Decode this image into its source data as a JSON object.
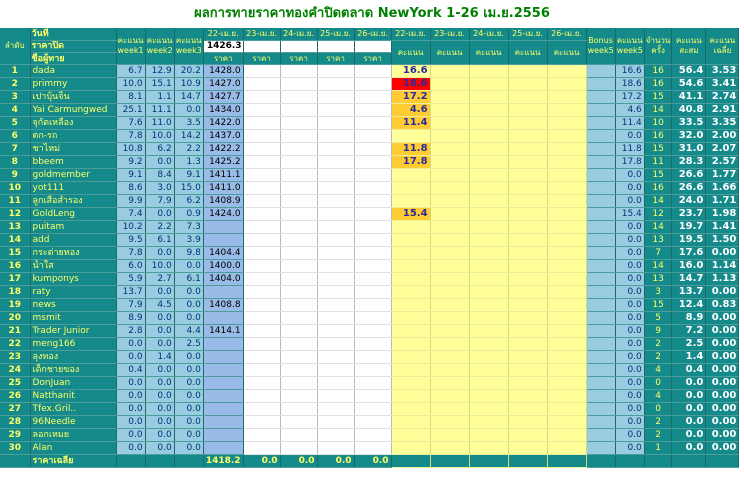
{
  "title": "ผลการทายราคาทองคำปิดตลาด NewYork 1-26 เม.ย.2556",
  "headers": {
    "date_label": "วันที่",
    "close_label": "ราคาปิด",
    "player_label": "ชื่อผู้ทาย",
    "rank_label": "ลำดับ",
    "week1": "คะแนน week1",
    "week2": "คะแนน week2",
    "week3": "คะแนน week3",
    "pred_dates": [
      "22-เม.ย.",
      "23-เม.ย.",
      "24-เม.ย.",
      "25-เม.ย.",
      "26-เม.ย."
    ],
    "score_dates": [
      "22-เม.ย.",
      "23-เม.ย.",
      "24-เม.ย.",
      "25-เม.ย.",
      "26-เม.ย."
    ],
    "close_price_22": "1426.3",
    "price_label": "ราคา",
    "score_label": "คะแนน",
    "bonus": "Bonus week5",
    "week5": "คะแนน week5",
    "count": "จำนวนครั้ง",
    "total": "คะแนนสะสม",
    "avg": "คะแนนเฉลี่ย"
  },
  "rows": [
    {
      "no": "1",
      "name": "dada",
      "w1": "6.7",
      "w2": "12.9",
      "w3": "20.2",
      "p22": "1428.0",
      "s22": "16.6",
      "w5": "16.6",
      "cnt": "16",
      "tot": "56.4",
      "avg": "3.53"
    },
    {
      "no": "2",
      "name": "primmy",
      "w1": "10.0",
      "w2": "15.1",
      "w3": "10.9",
      "p22": "1427.0",
      "s22": "18.6",
      "w5": "18.6",
      "cnt": "16",
      "tot": "54.6",
      "avg": "3.41"
    },
    {
      "no": "3",
      "name": "เปาบุ้นจิ้น",
      "w1": "8.1",
      "w2": "1.1",
      "w3": "14.7",
      "p22": "1427.7",
      "s22": "17.2",
      "w5": "17.2",
      "cnt": "15",
      "tot": "41.1",
      "avg": "2.74"
    },
    {
      "no": "4",
      "name": "Yai Carmungwed",
      "w1": "25.1",
      "w2": "11.1",
      "w3": "0.0",
      "p22": "1434.0",
      "s22": "4.6",
      "w5": "4.6",
      "cnt": "14",
      "tot": "40.8",
      "avg": "2.91"
    },
    {
      "no": "5",
      "name": "จุกัดเหลือง",
      "w1": "7.6",
      "w2": "11.0",
      "w3": "3.5",
      "p22": "1422.0",
      "s22": "11.4",
      "w5": "11.4",
      "cnt": "10",
      "tot": "33.5",
      "avg": "3.35"
    },
    {
      "no": "6",
      "name": "ตก-รถ",
      "w1": "7.8",
      "w2": "10.0",
      "w3": "14.2",
      "p22": "1437.0",
      "s22": "",
      "w5": "0.0",
      "cnt": "16",
      "tot": "32.0",
      "avg": "2.00"
    },
    {
      "no": "7",
      "name": "ชาไหม่",
      "w1": "10.8",
      "w2": "6.2",
      "w3": "2.2",
      "p22": "1422.2",
      "s22": "11.8",
      "w5": "11.8",
      "cnt": "15",
      "tot": "31.0",
      "avg": "2.07"
    },
    {
      "no": "8",
      "name": "bbeem",
      "w1": "9.2",
      "w2": "0.0",
      "w3": "1.3",
      "p22": "1425.2",
      "s22": "17.8",
      "w5": "17.8",
      "cnt": "11",
      "tot": "28.3",
      "avg": "2.57"
    },
    {
      "no": "9",
      "name": "goldmember",
      "w1": "9.1",
      "w2": "8.4",
      "w3": "9.1",
      "p22": "1411.1",
      "s22": "",
      "w5": "0.0",
      "cnt": "15",
      "tot": "26.6",
      "avg": "1.77"
    },
    {
      "no": "10",
      "name": "yot111",
      "w1": "8.6",
      "w2": "3.0",
      "w3": "15.0",
      "p22": "1411.0",
      "s22": "",
      "w5": "0.0",
      "cnt": "16",
      "tot": "26.6",
      "avg": "1.66"
    },
    {
      "no": "11",
      "name": "ลูกเสือสำรอง",
      "w1": "9.9",
      "w2": "7.9",
      "w3": "6.2",
      "p22": "1408.9",
      "s22": "",
      "w5": "0.0",
      "cnt": "14",
      "tot": "24.0",
      "avg": "1.71"
    },
    {
      "no": "12",
      "name": "GoldLeng",
      "w1": "7.4",
      "w2": "0.0",
      "w3": "0.9",
      "p22": "1424.0",
      "s22": "15.4",
      "w5": "15.4",
      "cnt": "12",
      "tot": "23.7",
      "avg": "1.98"
    },
    {
      "no": "13",
      "name": "puitam",
      "w1": "10.2",
      "w2": "2.2",
      "w3": "7.3",
      "p22": "",
      "s22": "",
      "w5": "0.0",
      "cnt": "14",
      "tot": "19.7",
      "avg": "1.41"
    },
    {
      "no": "14",
      "name": "add",
      "w1": "9.5",
      "w2": "6.1",
      "w3": "3.9",
      "p22": "",
      "s22": "",
      "w5": "0.0",
      "cnt": "13",
      "tot": "19.5",
      "avg": "1.50"
    },
    {
      "no": "15",
      "name": "กระต่ายทอง",
      "w1": "7.8",
      "w2": "0.0",
      "w3": "9.8",
      "p22": "1404.4",
      "s22": "",
      "w5": "0.0",
      "cnt": "7",
      "tot": "17.6",
      "avg": "0.00"
    },
    {
      "no": "16",
      "name": "น้ำใส",
      "w1": "6.0",
      "w2": "10.0",
      "w3": "0.0",
      "p22": "1400.0",
      "s22": "",
      "w5": "0.0",
      "cnt": "14",
      "tot": "16.0",
      "avg": "1.14"
    },
    {
      "no": "17",
      "name": "kumponys",
      "w1": "5.9",
      "w2": "2.7",
      "w3": "6.1",
      "p22": "1404.0",
      "s22": "",
      "w5": "0.0",
      "cnt": "13",
      "tot": "14.7",
      "avg": "1.13"
    },
    {
      "no": "18",
      "name": "raty",
      "w1": "13.7",
      "w2": "0.0",
      "w3": "0.0",
      "p22": "",
      "s22": "",
      "w5": "0.0",
      "cnt": "3",
      "tot": "13.7",
      "avg": "0.00"
    },
    {
      "no": "19",
      "name": "news",
      "w1": "7.9",
      "w2": "4.5",
      "w3": "0.0",
      "p22": "1408.8",
      "s22": "",
      "w5": "0.0",
      "cnt": "15",
      "tot": "12.4",
      "avg": "0.83"
    },
    {
      "no": "20",
      "name": "msmit",
      "w1": "8.9",
      "w2": "0.0",
      "w3": "0.0",
      "p22": "",
      "s22": "",
      "w5": "0.0",
      "cnt": "5",
      "tot": "8.9",
      "avg": "0.00"
    },
    {
      "no": "21",
      "name": "Trader Junior",
      "w1": "2.8",
      "w2": "0.0",
      "w3": "4.4",
      "p22": "1414.1",
      "s22": "",
      "w5": "0.0",
      "cnt": "9",
      "tot": "7.2",
      "avg": "0.00"
    },
    {
      "no": "22",
      "name": "meng166",
      "w1": "0.0",
      "w2": "0.0",
      "w3": "2.5",
      "p22": "",
      "s22": "",
      "w5": "0.0",
      "cnt": "2",
      "tot": "2.5",
      "avg": "0.00"
    },
    {
      "no": "23",
      "name": "ลุงทอง",
      "w1": "0.0",
      "w2": "1.4",
      "w3": "0.0",
      "p22": "",
      "s22": "",
      "w5": "0.0",
      "cnt": "2",
      "tot": "1.4",
      "avg": "0.00"
    },
    {
      "no": "24",
      "name": "เด็กชายของ",
      "w1": "0.4",
      "w2": "0.0",
      "w3": "0.0",
      "p22": "",
      "s22": "",
      "w5": "0.0",
      "cnt": "4",
      "tot": "0.4",
      "avg": "0.00"
    },
    {
      "no": "25",
      "name": "DonJuan",
      "w1": "0.0",
      "w2": "0.0",
      "w3": "0.0",
      "p22": "",
      "s22": "",
      "w5": "0.0",
      "cnt": "0",
      "tot": "0.0",
      "avg": "0.00"
    },
    {
      "no": "26",
      "name": "Natthanit",
      "w1": "0.0",
      "w2": "0.0",
      "w3": "0.0",
      "p22": "",
      "s22": "",
      "w5": "0.0",
      "cnt": "4",
      "tot": "0.0",
      "avg": "0.00"
    },
    {
      "no": "27",
      "name": "Tfex.Gril..",
      "w1": "0.0",
      "w2": "0.0",
      "w3": "0.0",
      "p22": "",
      "s22": "",
      "w5": "0.0",
      "cnt": "0",
      "tot": "0.0",
      "avg": "0.00"
    },
    {
      "no": "28",
      "name": "96Needle",
      "w1": "0.0",
      "w2": "0.0",
      "w3": "0.0",
      "p22": "",
      "s22": "",
      "w5": "0.0",
      "cnt": "2",
      "tot": "0.0",
      "avg": "0.00"
    },
    {
      "no": "29",
      "name": "ลอกเหมย",
      "w1": "0.0",
      "w2": "0.0",
      "w3": "0.0",
      "p22": "",
      "s22": "",
      "w5": "0.0",
      "cnt": "2",
      "tot": "0.0",
      "avg": "0.00"
    },
    {
      "no": "30",
      "name": "Alan",
      "w1": "0.0",
      "w2": "0.0",
      "w3": "0.0",
      "p22": "",
      "s22": "",
      "w5": "0.0",
      "cnt": "1",
      "tot": "0.0",
      "avg": "0.00"
    }
  ],
  "footer": {
    "label": "ราคาเฉลี่ย",
    "avg22": "1418.2",
    "avg23": "0.0",
    "avg24": "0.0",
    "avg25": "0.0",
    "avg26": "0.0"
  },
  "colors": {
    "teal": "#148a8a",
    "yellow_text": "#ffff66",
    "score_bg": "#ffff99",
    "score_highlight": "#ffcc33",
    "score_red": "#ff0000",
    "title_green": "#008000"
  }
}
